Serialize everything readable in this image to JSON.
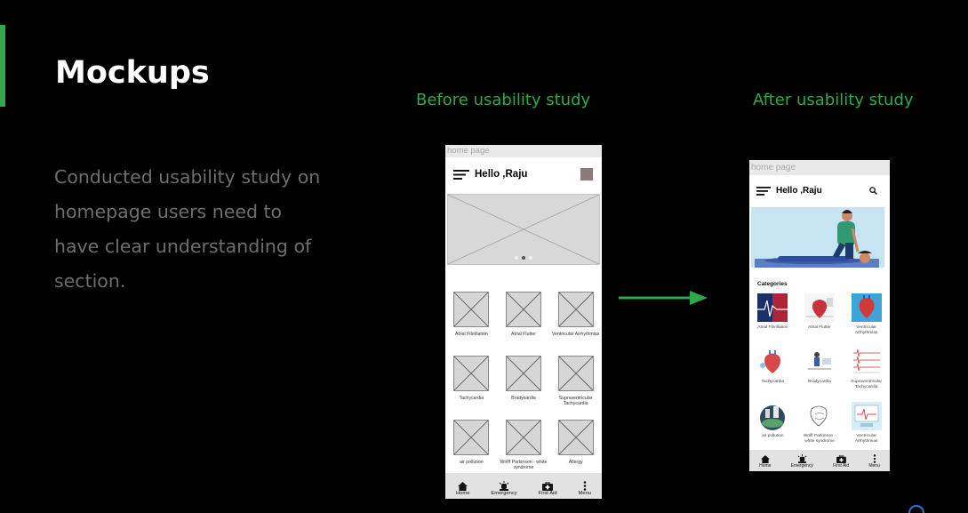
{
  "slide": {
    "title": "Mockups",
    "description": "Conducted usability study on homepage users need to have clear understanding of section.",
    "before_label": "Before usability study",
    "after_label": "After usability study",
    "accent_color": "#2ea84a"
  },
  "before_phone": {
    "page_label": "home page",
    "greeting": "Hello ,Raju",
    "grid": [
      [
        "Atrial Fibrillation",
        "Atrial Flutter",
        "Ventricular Arrhythmias"
      ],
      [
        "Tachycardia",
        "Bradycardia",
        "Supraventricular Tachycardia"
      ],
      [
        "air pollution",
        "Wolff Parkinson - white syndrome",
        "Allergy"
      ]
    ],
    "nav": [
      "Home",
      "Emergency",
      "First Aid",
      "Menu"
    ]
  },
  "after_phone": {
    "page_label": "home page",
    "greeting": "Hello ,Raju",
    "categories_title": "Categories",
    "grid": [
      [
        "Atrial Fibrillation",
        "Atrial Flutter",
        "Ventricular Arrhythmias"
      ],
      [
        "Tachycardia",
        "Bradycardia",
        "Supraventricular Tachycardia"
      ],
      [
        "air pollution",
        "Wolff Parkinson - white syndrome",
        "Ventricular Arrhythmias"
      ]
    ],
    "nav": [
      "Home",
      "Emergency",
      "First Aid",
      "Menu"
    ]
  },
  "icons": {
    "menu": "hamburger-icon",
    "search": "search-icon",
    "home": "home-icon",
    "emergency": "siren-icon",
    "first_aid": "first-aid-kit-icon",
    "more": "more-vertical-icon"
  }
}
